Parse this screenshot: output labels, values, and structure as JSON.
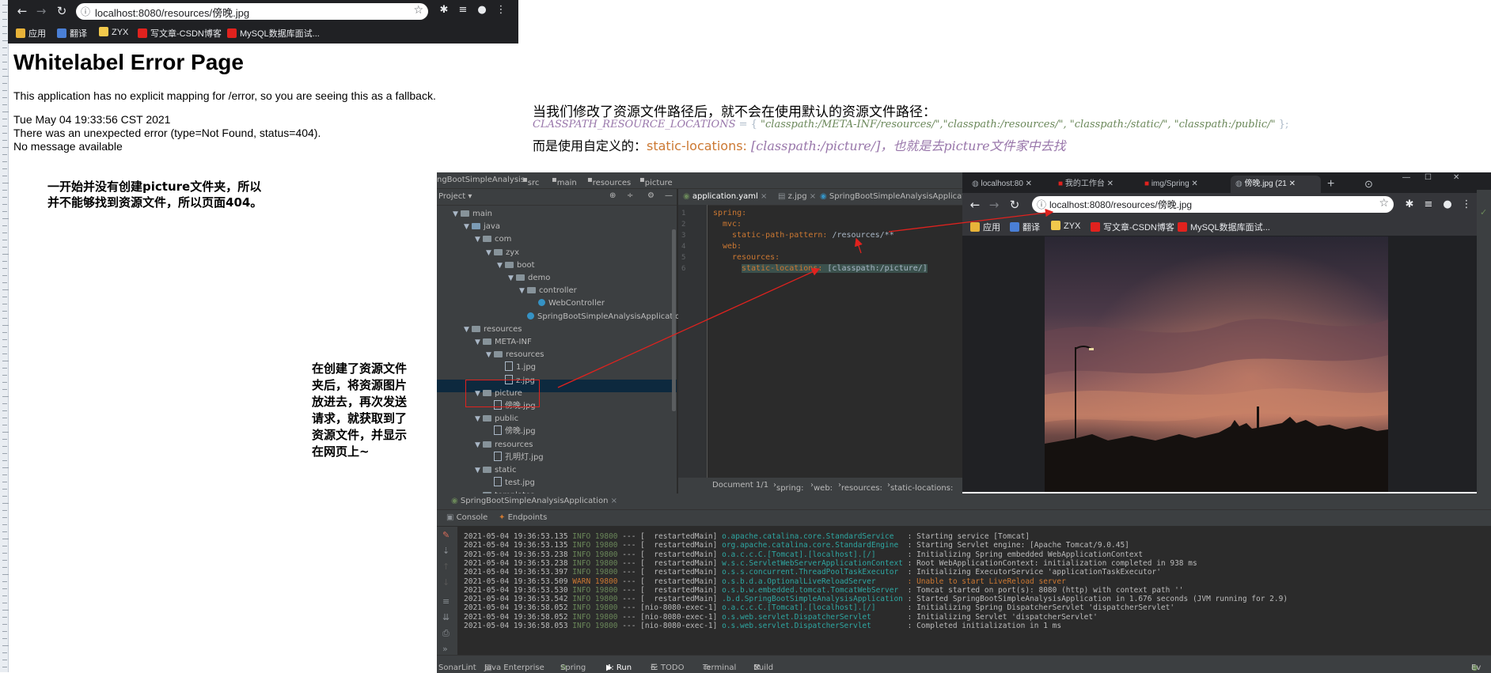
{
  "left_browser": {
    "url": "localhost:8080/resources/傍晚.jpg",
    "bookmarks": [
      "应用",
      "翻译",
      "ZYX",
      "写文章-CSDN博客",
      "MySQL数据库面试..."
    ]
  },
  "error_page": {
    "title": "Whitelabel Error Page",
    "line1": "This application has no explicit mapping for /error, so you are seeing this as a fallback.",
    "date": "Tue May 04 19:33:56 CST 2021",
    "error": "There was an unexpected error (type=Not Found, status=404).",
    "message": "No message available"
  },
  "notes": {
    "note1": [
      "一开始并没有创建picture文件夹，所以",
      "并不能够找到资源文件，所以页面404。"
    ],
    "note2": [
      "在创建了资源文件",
      "夹后，将资源图片",
      "放进去，再次发送",
      "请求，就获取到了",
      "资源文件，并显示",
      "在网页上~"
    ],
    "heading": "当我们修改了资源文件路径后，就不会在使用默认的资源文件路径：",
    "cp_name": "CLASSPATH_RESOURCE_LOCATIONS",
    "cp_eq": " = { ",
    "cp_values": "\"classpath:/META-INF/resources/\",\"classpath:/resources/\", \"classpath:/static/\", \"classpath:/public/\"",
    "cp_end": " };",
    "custom_prefix": "而是使用自定义的：",
    "custom_key": "static-locations: ",
    "custom_value": "[classpath:/picture/]，也就是去picture文件家中去找"
  },
  "ide": {
    "breadcrumb": [
      "ngBootSimpleAnalysis",
      "src",
      "main",
      "resources",
      "picture"
    ],
    "project_label": "Project ▾",
    "tree": [
      {
        "label": "main",
        "indent": 1,
        "arrow": "▼",
        "kind": "folder"
      },
      {
        "label": "java",
        "indent": 2,
        "arrow": "▼",
        "kind": "folder-blue"
      },
      {
        "label": "com",
        "indent": 3,
        "arrow": "▼",
        "kind": "folder"
      },
      {
        "label": "zyx",
        "indent": 4,
        "arrow": "▼",
        "kind": "folder"
      },
      {
        "label": "boot",
        "indent": 5,
        "arrow": "▼",
        "kind": "folder"
      },
      {
        "label": "demo",
        "indent": 6,
        "arrow": "▼",
        "kind": "folder"
      },
      {
        "label": "controller",
        "indent": 7,
        "arrow": "▼",
        "kind": "folder"
      },
      {
        "label": "WebController",
        "indent": 8,
        "arrow": "",
        "kind": "class"
      },
      {
        "label": "SpringBootSimpleAnalysisApplication",
        "indent": 7,
        "arrow": "",
        "kind": "class"
      },
      {
        "label": "resources",
        "indent": 2,
        "arrow": "▼",
        "kind": "folder"
      },
      {
        "label": "META-INF",
        "indent": 3,
        "arrow": "▼",
        "kind": "folder"
      },
      {
        "label": "resources",
        "indent": 4,
        "arrow": "▼",
        "kind": "folder"
      },
      {
        "label": "1.jpg",
        "indent": 5,
        "arrow": "",
        "kind": "file"
      },
      {
        "label": "z.jpg",
        "indent": 5,
        "arrow": "",
        "kind": "file"
      },
      {
        "label": "picture",
        "indent": 3,
        "arrow": "▼",
        "kind": "folder"
      },
      {
        "label": "傍晚.jpg",
        "indent": 4,
        "arrow": "",
        "kind": "file"
      },
      {
        "label": "public",
        "indent": 3,
        "arrow": "▼",
        "kind": "folder"
      },
      {
        "label": "傍晚.jpg",
        "indent": 4,
        "arrow": "",
        "kind": "file"
      },
      {
        "label": "resources",
        "indent": 3,
        "arrow": "▼",
        "kind": "folder"
      },
      {
        "label": "孔明灯.jpg",
        "indent": 4,
        "arrow": "",
        "kind": "file"
      },
      {
        "label": "static",
        "indent": 3,
        "arrow": "▼",
        "kind": "folder"
      },
      {
        "label": "test.jpg",
        "indent": 4,
        "arrow": "",
        "kind": "file"
      },
      {
        "label": "templates",
        "indent": 3,
        "arrow": "",
        "kind": "folder"
      }
    ],
    "editor_tabs": [
      "application.yaml",
      "z.jpg",
      "SpringBootSimpleAnalysisApplication"
    ],
    "code": [
      {
        "n": "1",
        "text": "spring:",
        "indent": 0
      },
      {
        "n": "2",
        "text": "mvc:",
        "indent": 1
      },
      {
        "n": "3",
        "text": "static-path-pattern: /resources/**",
        "indent": 2
      },
      {
        "n": "4",
        "text": "web:",
        "indent": 1
      },
      {
        "n": "5",
        "text": "resources:",
        "indent": 2
      },
      {
        "n": "6",
        "text": "static-locations: [classpath:/picture/]",
        "indent": 3
      }
    ],
    "status": [
      "Document 1/1",
      "spring:",
      "web:",
      "resources:",
      "static-locations:"
    ],
    "run_tab": "SpringBootSimpleAnalysisApplication",
    "console_tabs": [
      "Console",
      "Endpoints"
    ],
    "logs": [
      {
        "ts": "2021-05-04 19:36:53.135",
        "lv": "INFO",
        "pid": "19800",
        "th": "[  restartedMain]",
        "lg": "o.apache.catalina.core.StandardService  ",
        "ms": ": Starting service [Tomcat]"
      },
      {
        "ts": "2021-05-04 19:36:53.135",
        "lv": "INFO",
        "pid": "19800",
        "th": "[  restartedMain]",
        "lg": "org.apache.catalina.core.StandardEngine ",
        "ms": ": Starting Servlet engine: [Apache Tomcat/9.0.45]"
      },
      {
        "ts": "2021-05-04 19:36:53.238",
        "lv": "INFO",
        "pid": "19800",
        "th": "[  restartedMain]",
        "lg": "o.a.c.c.C.[Tomcat].[localhost].[/]      ",
        "ms": ": Initializing Spring embedded WebApplicationContext"
      },
      {
        "ts": "2021-05-04 19:36:53.238",
        "lv": "INFO",
        "pid": "19800",
        "th": "[  restartedMain]",
        "lg": "w.s.c.ServletWebServerApplicationContext",
        "ms": ": Root WebApplicationContext: initialization completed in 938 ms"
      },
      {
        "ts": "2021-05-04 19:36:53.397",
        "lv": "INFO",
        "pid": "19800",
        "th": "[  restartedMain]",
        "lg": "o.s.s.concurrent.ThreadPoolTaskExecutor ",
        "ms": ": Initializing ExecutorService 'applicationTaskExecutor'"
      },
      {
        "ts": "2021-05-04 19:36:53.509",
        "lv": "WARN",
        "pid": "19800",
        "th": "[  restartedMain]",
        "lg": "o.s.b.d.a.OptionalLiveReloadServer      ",
        "ms": ": Unable to start LiveReload server"
      },
      {
        "ts": "2021-05-04 19:36:53.530",
        "lv": "INFO",
        "pid": "19800",
        "th": "[  restartedMain]",
        "lg": "o.s.b.w.embedded.tomcat.TomcatWebServer ",
        "ms": ": Tomcat started on port(s): 8080 (http) with context path ''"
      },
      {
        "ts": "2021-05-04 19:36:53.542",
        "lv": "INFO",
        "pid": "19800",
        "th": "[  restartedMain]",
        "lg": ".b.d.SpringBootSimpleAnalysisApplication",
        "ms": ": Started SpringBootSimpleAnalysisApplication in 1.676 seconds (JVM running for 2.9)"
      },
      {
        "ts": "2021-05-04 19:36:58.052",
        "lv": "INFO",
        "pid": "19800",
        "th": "[nio-8080-exec-1]",
        "lg": "o.a.c.c.C.[Tomcat].[localhost].[/]      ",
        "ms": ": Initializing Spring DispatcherServlet 'dispatcherServlet'"
      },
      {
        "ts": "2021-05-04 19:36:58.052",
        "lv": "INFO",
        "pid": "19800",
        "th": "[nio-8080-exec-1]",
        "lg": "o.s.web.servlet.DispatcherServlet       ",
        "ms": ": Initializing Servlet 'dispatcherServlet'"
      },
      {
        "ts": "2021-05-04 19:36:58.053",
        "lv": "INFO",
        "pid": "19800",
        "th": "[nio-8080-exec-1]",
        "lg": "o.s.web.servlet.DispatcherServlet       ",
        "ms": ": Completed initialization in 1 ms"
      }
    ],
    "bottom_tabs": [
      "SonarLint",
      "Java Enterprise",
      "Spring",
      "4: Run",
      "6: TODO",
      "Terminal",
      "Build"
    ],
    "bottom_right": "Ev"
  },
  "right_browser": {
    "tabs": [
      "localhost:80",
      "我的工作台",
      "img/Spring",
      "傍晚.jpg (21"
    ],
    "url": "localhost:8080/resources/傍晚.jpg",
    "bookmarks": [
      "应用",
      "翻译",
      "ZYX",
      "写文章-CSDN博客",
      "MySQL数据库面试..."
    ]
  },
  "colors": {
    "annotation_red": "#e0221e",
    "ide_bg": "#2b2b2b",
    "ide_panel": "#3c3f41",
    "chrome_dark": "#202124"
  }
}
